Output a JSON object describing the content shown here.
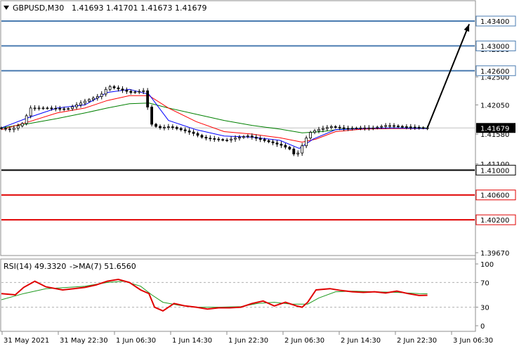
{
  "header": {
    "symbol_label": "GBPUSD,M30",
    "ohlc_label": "1.41693 1.41701 1.41673 1.41679"
  },
  "rsi_header": {
    "label": "RSI(14) 49.3320",
    "ma_label": "->MA(7) 51.6560"
  },
  "colors": {
    "candles": "#000000",
    "ma_fast": "#0000ff",
    "ma_mid": "#ff0000",
    "ma_slow": "#008000",
    "resistance": "#4a7bb0",
    "pivot": "#000000",
    "support": "#e00000",
    "rsi": "#e00000",
    "rsi_ma": "#1f9a1f",
    "current_price": "#c0c0c0",
    "arrow": "#000000"
  },
  "chart_data": [
    {
      "type": "candlestick",
      "title": "GBPUSD,M30",
      "y_axis_ticks": [
        "1.43400",
        "1.42950",
        "1.42500",
        "1.42050",
        "1.41580",
        "1.41100",
        "1.40650",
        "1.40200",
        "1.39670"
      ],
      "ylim": [
        1.3967,
        1.434
      ],
      "x_axis_ticks": [
        "31 May 2021",
        "31 May 22:30",
        "1 Jun 06:30",
        "1 Jun 14:30",
        "1 Jun 22:30",
        "2 Jun 06:30",
        "2 Jun 14:30",
        "2 Jun 22:30",
        "3 Jun 06:30"
      ],
      "current_price": {
        "label": "1.41679",
        "value": 1.41679
      },
      "levels": [
        {
          "label": "1.43400",
          "value": 1.434,
          "kind": "resistance"
        },
        {
          "label": "1.43000",
          "value": 1.43,
          "kind": "resistance"
        },
        {
          "label": "1.42600",
          "value": 1.426,
          "kind": "resistance"
        },
        {
          "label": "1.41000",
          "value": 1.41,
          "kind": "pivot"
        },
        {
          "label": "1.40600",
          "value": 1.406,
          "kind": "support"
        },
        {
          "label": "1.40200",
          "value": 1.402,
          "kind": "support"
        }
      ],
      "series_path": [
        [
          0,
          1.4168
        ],
        [
          5,
          1.4165
        ],
        [
          9,
          1.4175
        ],
        [
          12,
          1.42
        ],
        [
          18,
          1.42
        ],
        [
          25,
          1.4198
        ],
        [
          32,
          1.4212
        ],
        [
          37,
          1.422
        ],
        [
          40,
          1.4235
        ],
        [
          44,
          1.423
        ],
        [
          48,
          1.4225
        ],
        [
          53,
          1.4228
        ],
        [
          55,
          1.4175
        ],
        [
          58,
          1.4168
        ],
        [
          62,
          1.417
        ],
        [
          66,
          1.4165
        ],
        [
          70,
          1.416
        ],
        [
          74,
          1.4152
        ],
        [
          78,
          1.415
        ],
        [
          82,
          1.4148
        ],
        [
          86,
          1.4152
        ],
        [
          90,
          1.4155
        ],
        [
          94,
          1.415
        ],
        [
          98,
          1.4145
        ],
        [
          102,
          1.414
        ],
        [
          106,
          1.4132
        ],
        [
          107,
          1.412
        ],
        [
          109,
          1.4135
        ],
        [
          112,
          1.416
        ],
        [
          115,
          1.4165
        ],
        [
          120,
          1.417
        ],
        [
          125,
          1.4167
        ],
        [
          130,
          1.4168
        ],
        [
          135,
          1.4168
        ],
        [
          140,
          1.4172
        ],
        [
          145,
          1.417
        ],
        [
          150,
          1.4169
        ],
        [
          153,
          1.41679
        ]
      ],
      "ma_fast": [
        [
          0,
          1.4168
        ],
        [
          10,
          1.4185
        ],
        [
          20,
          1.42
        ],
        [
          30,
          1.4205
        ],
        [
          38,
          1.4225
        ],
        [
          46,
          1.423
        ],
        [
          53,
          1.4222
        ],
        [
          60,
          1.418
        ],
        [
          70,
          1.4165
        ],
        [
          80,
          1.4155
        ],
        [
          90,
          1.4153
        ],
        [
          100,
          1.4148
        ],
        [
          107,
          1.4135
        ],
        [
          112,
          1.415
        ],
        [
          120,
          1.4165
        ],
        [
          130,
          1.4167
        ],
        [
          140,
          1.4168
        ],
        [
          153,
          1.4167
        ]
      ],
      "ma_mid": [
        [
          0,
          1.4165
        ],
        [
          10,
          1.4178
        ],
        [
          20,
          1.4192
        ],
        [
          30,
          1.42
        ],
        [
          38,
          1.4212
        ],
        [
          46,
          1.422
        ],
        [
          53,
          1.422
        ],
        [
          60,
          1.42
        ],
        [
          70,
          1.4178
        ],
        [
          80,
          1.4162
        ],
        [
          90,
          1.4158
        ],
        [
          100,
          1.4152
        ],
        [
          108,
          1.4145
        ],
        [
          113,
          1.415
        ],
        [
          120,
          1.4162
        ],
        [
          130,
          1.4166
        ],
        [
          140,
          1.4167
        ],
        [
          153,
          1.4167
        ]
      ],
      "ma_slow": [
        [
          0,
          1.4168
        ],
        [
          10,
          1.4175
        ],
        [
          20,
          1.4183
        ],
        [
          30,
          1.4192
        ],
        [
          38,
          1.42
        ],
        [
          46,
          1.4207
        ],
        [
          53,
          1.4208
        ],
        [
          60,
          1.42
        ],
        [
          70,
          1.419
        ],
        [
          80,
          1.418
        ],
        [
          90,
          1.4172
        ],
        [
          100,
          1.4166
        ],
        [
          108,
          1.416
        ],
        [
          115,
          1.4162
        ],
        [
          122,
          1.4166
        ],
        [
          130,
          1.4167
        ],
        [
          140,
          1.4168
        ],
        [
          153,
          1.4168
        ]
      ],
      "projection_arrow": {
        "from": [
          153,
          1.4168
        ],
        "to": [
          168,
          1.4335
        ]
      }
    },
    {
      "type": "line",
      "title": "RSI(14) 49.3320 ->MA(7) 51.6560",
      "y_axis_ticks": [
        "100",
        "70",
        "30",
        "0"
      ],
      "ylim": [
        0,
        100
      ],
      "reference_levels": [
        70,
        30
      ],
      "series": [
        {
          "name": "RSI(14)",
          "values": [
            [
              0,
              52
            ],
            [
              5,
              50
            ],
            [
              8,
              62
            ],
            [
              12,
              72
            ],
            [
              16,
              63
            ],
            [
              22,
              58
            ],
            [
              26,
              60
            ],
            [
              30,
              62
            ],
            [
              34,
              66
            ],
            [
              38,
              72
            ],
            [
              42,
              75
            ],
            [
              46,
              70
            ],
            [
              50,
              58
            ],
            [
              53,
              52
            ],
            [
              55,
              30
            ],
            [
              58,
              24
            ],
            [
              62,
              36
            ],
            [
              66,
              32
            ],
            [
              70,
              30
            ],
            [
              74,
              27
            ],
            [
              78,
              29
            ],
            [
              82,
              29
            ],
            [
              86,
              30
            ],
            [
              90,
              36
            ],
            [
              94,
              40
            ],
            [
              98,
              32
            ],
            [
              102,
              38
            ],
            [
              106,
              32
            ],
            [
              108,
              30
            ],
            [
              110,
              38
            ],
            [
              113,
              58
            ],
            [
              118,
              60
            ],
            [
              122,
              57
            ],
            [
              126,
              55
            ],
            [
              130,
              54
            ],
            [
              134,
              55
            ],
            [
              138,
              53
            ],
            [
              142,
              56
            ],
            [
              146,
              52
            ],
            [
              150,
              49
            ],
            [
              153,
              49.33
            ]
          ]
        },
        {
          "name": "MA(7)",
          "values": [
            [
              0,
              42
            ],
            [
              8,
              52
            ],
            [
              16,
              60
            ],
            [
              24,
              62
            ],
            [
              30,
              64
            ],
            [
              38,
              70
            ],
            [
              44,
              72
            ],
            [
              50,
              64
            ],
            [
              54,
              50
            ],
            [
              58,
              38
            ],
            [
              64,
              33
            ],
            [
              70,
              30
            ],
            [
              78,
              30
            ],
            [
              86,
              31
            ],
            [
              92,
              36
            ],
            [
              98,
              38
            ],
            [
              104,
              35
            ],
            [
              110,
              35
            ],
            [
              114,
              45
            ],
            [
              120,
              55
            ],
            [
              126,
              56
            ],
            [
              134,
              55
            ],
            [
              142,
              54
            ],
            [
              150,
              52
            ],
            [
              153,
              51.656
            ]
          ]
        }
      ]
    }
  ]
}
